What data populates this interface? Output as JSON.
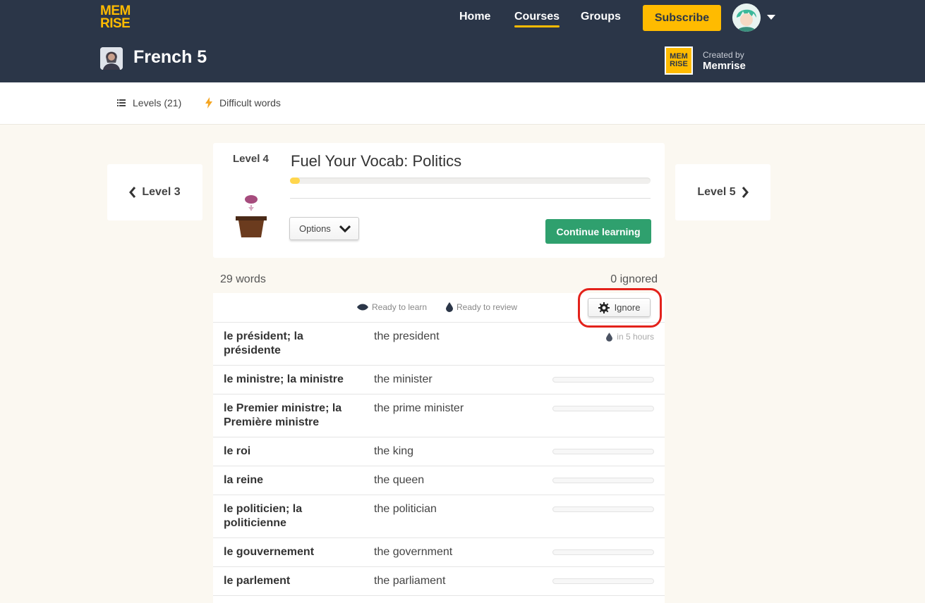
{
  "header": {
    "logo_top": "MEM",
    "logo_bottom": "RISE",
    "nav": [
      "Home",
      "Courses",
      "Groups"
    ],
    "subscribe_label": "Subscribe",
    "course_title": "French 5",
    "creator_logo_top": "MEM",
    "creator_logo_bottom": "RISE",
    "created_by_label": "Created by",
    "creator_name": "Memrise"
  },
  "subnav": {
    "levels_label": "Levels (21)",
    "difficult_label": "Difficult words"
  },
  "level_nav": {
    "prev_label": "Level 3",
    "next_label": "Level 5"
  },
  "level": {
    "label": "Level 4",
    "title": "Fuel Your Vocab: Politics",
    "progress_fraction": 0.028,
    "options_label": "Options",
    "continue_label": "Continue learning"
  },
  "counts": {
    "words": "29 words",
    "ignored": "0 ignored"
  },
  "table": {
    "legend_learn": "Ready to learn",
    "legend_review": "Ready to review",
    "ignore_label": "Ignore",
    "rows": [
      {
        "word": "le président; la présidente",
        "definition": "the president",
        "status": "in 5 hours"
      },
      {
        "word": "le ministre; la ministre",
        "definition": "the minister"
      },
      {
        "word": "le Premier ministre; la Première ministre",
        "definition": "the prime minister"
      },
      {
        "word": "le roi",
        "definition": "the king"
      },
      {
        "word": "la reine",
        "definition": "the queen"
      },
      {
        "word": "le politicien; la politicienne",
        "definition": "the politician"
      },
      {
        "word": "le gouvernement",
        "definition": "the government"
      },
      {
        "word": "le parlement",
        "definition": "the parliament"
      }
    ]
  },
  "colors": {
    "header_bg": "#2b3648",
    "brand_yellow": "#ffbb00",
    "continue_green": "#2fa06e",
    "highlight_red": "#e3221b",
    "page_bg": "#fbf8f1"
  },
  "icons": {
    "levels": "list-icon",
    "difficult": "lightning-icon",
    "prev": "chevron-left-icon",
    "next": "chevron-right-icon",
    "options": "chevron-down-icon",
    "ready_to_learn": "eye-icon",
    "ready_to_review": "water-drop-icon",
    "ignore": "gear-icon"
  }
}
